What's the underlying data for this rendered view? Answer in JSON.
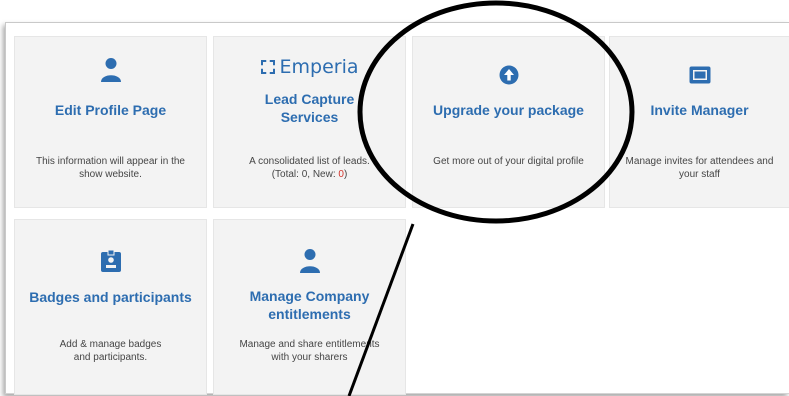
{
  "colors": {
    "accent": "#2d6db0",
    "new_count": "#d2342b",
    "card_bg": "#f3f3f3"
  },
  "cards": [
    {
      "icon": "user-icon",
      "title": "Edit Profile Page",
      "description": "This information will appear in the show website."
    },
    {
      "icon": "emperia-logo",
      "brand": "Emperia",
      "title": "Lead Capture Services",
      "description_prefix": "A consolidated list of leads. (Total: 0, New: ",
      "new_count": "0",
      "description_suffix": ")"
    },
    {
      "icon": "upload-arrow-icon",
      "title": "Upgrade your package",
      "description": "Get more out of your digital profile"
    },
    {
      "icon": "email-icon",
      "title": "Invite Manager",
      "description": "Manage invites for attendees and your staff"
    },
    {
      "icon": "badge-icon",
      "title": "Badges and participants",
      "description": "Add & manage badges and participants."
    },
    {
      "icon": "user-icon",
      "title": "Manage Company entitlements",
      "description": "Manage and share entitlements with your sharers"
    }
  ]
}
